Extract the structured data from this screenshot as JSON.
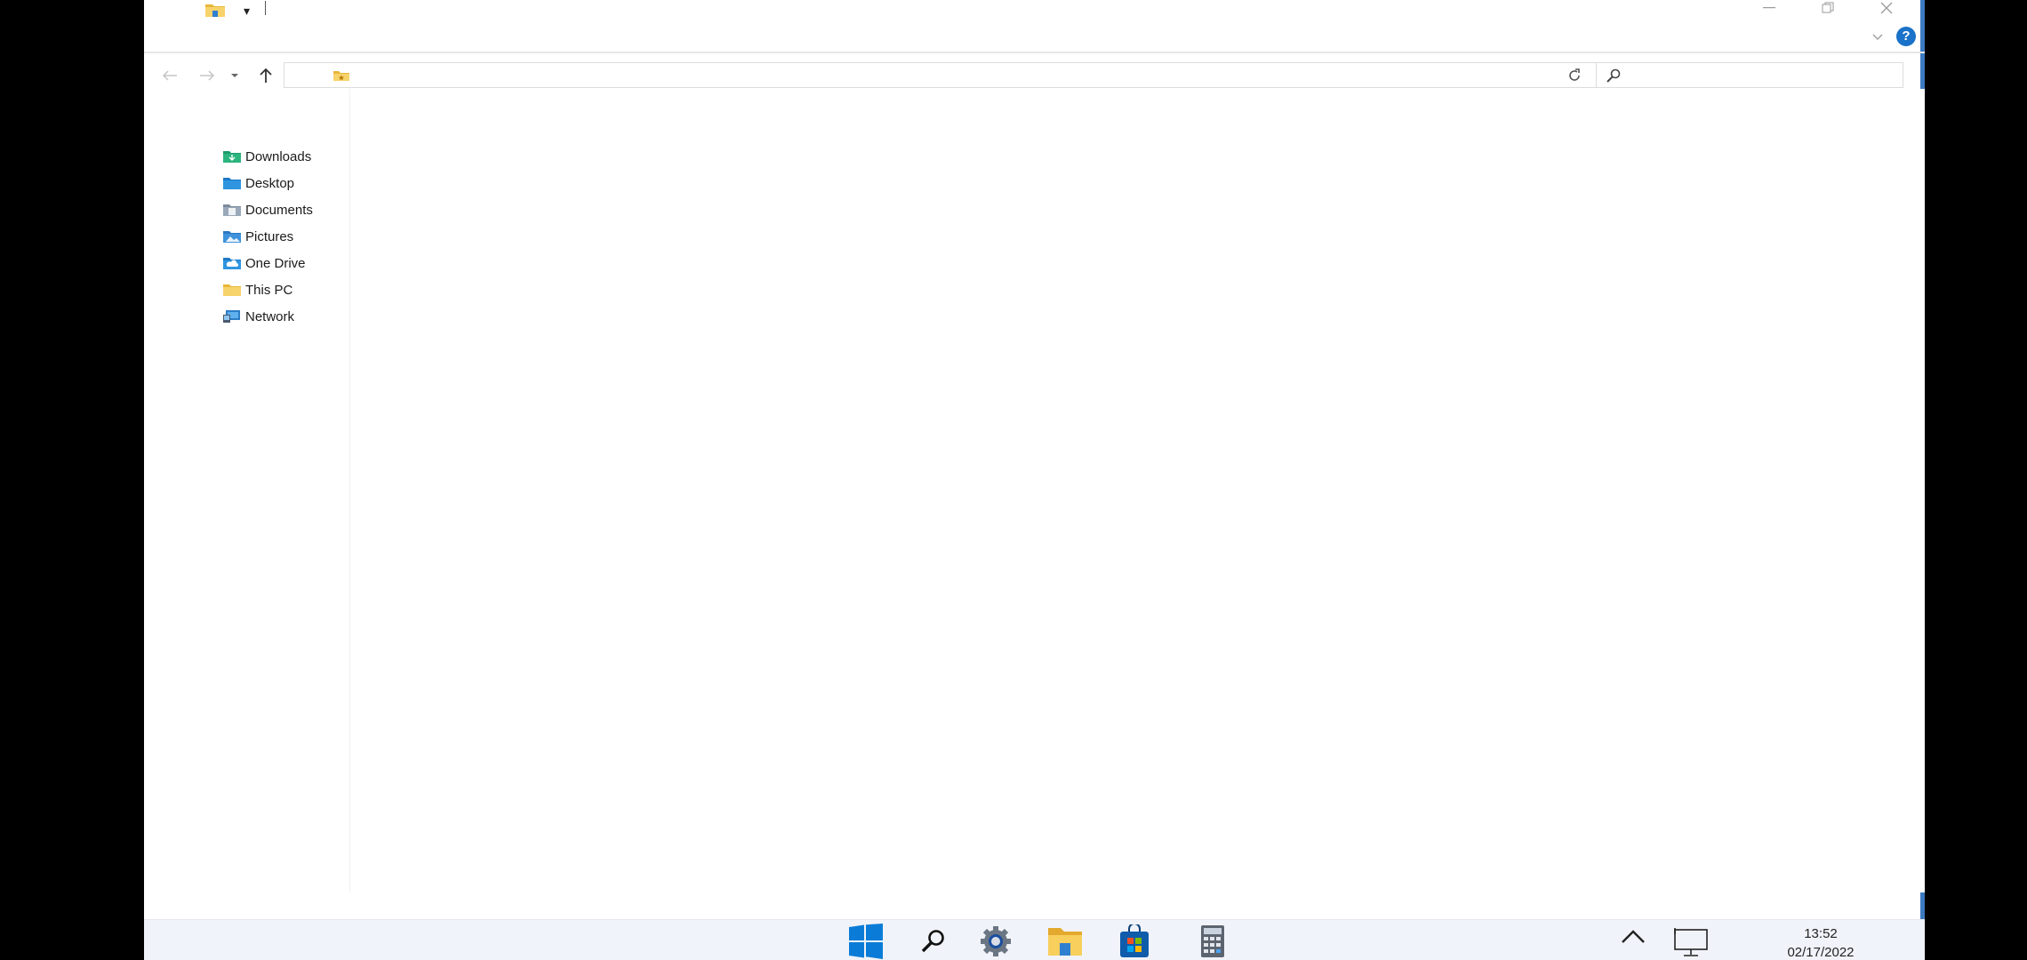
{
  "window": {
    "title": "",
    "quick_access_dropdown": "▾",
    "help_label": "?"
  },
  "address_bar": {
    "path": "",
    "search_placeholder": ""
  },
  "navigation_pane": {
    "items": [
      {
        "label": "Downloads",
        "icon": "downloads-icon"
      },
      {
        "label": "Desktop",
        "icon": "desktop-folder-icon"
      },
      {
        "label": "Documents",
        "icon": "documents-icon"
      },
      {
        "label": "Pictures",
        "icon": "pictures-icon"
      },
      {
        "label": "One Drive",
        "icon": "onedrive-icon"
      },
      {
        "label": "This PC",
        "icon": "this-pc-icon"
      },
      {
        "label": "Network",
        "icon": "network-icon"
      }
    ]
  },
  "taskbar": {
    "apps": [
      "start-icon",
      "search-icon",
      "settings-icon",
      "file-explorer-icon",
      "store-icon",
      "calculator-icon"
    ],
    "time": "13:52",
    "date": "02/17/2022"
  },
  "colors": {
    "accent": "#1a72c9",
    "folder_yellow": "#f5c542",
    "taskbar_bg": "#f0f3f9"
  }
}
